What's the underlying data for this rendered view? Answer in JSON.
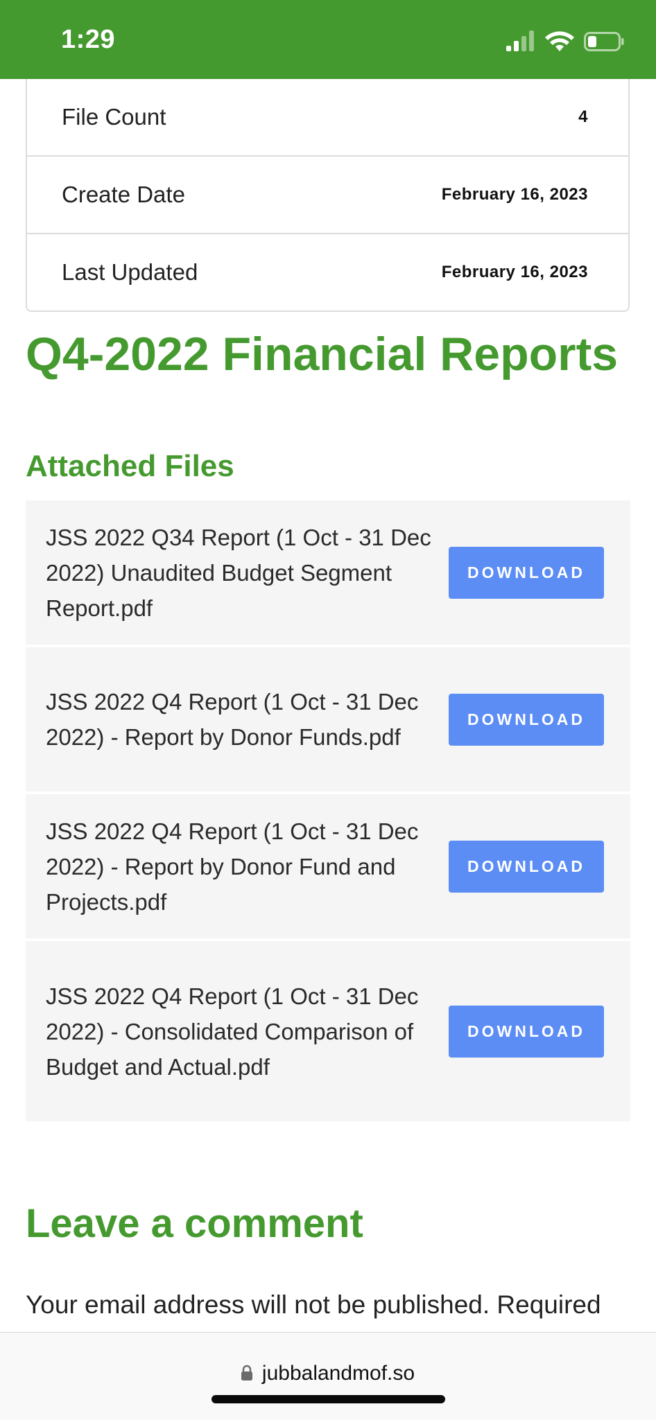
{
  "status_bar": {
    "time": "1:29",
    "background_color": "#459a2f",
    "icons": [
      "cellular-signal-icon",
      "wifi-icon",
      "battery-icon"
    ]
  },
  "meta": {
    "rows": [
      {
        "label": "File Count",
        "value": "4"
      },
      {
        "label": "Create Date",
        "value": "February 16, 2023"
      },
      {
        "label": "Last Updated",
        "value": "February 16, 2023"
      }
    ]
  },
  "page": {
    "title": "Q4-2022 Financial Reports",
    "attached_files_heading": "Attached Files",
    "accent_color": "#459a2f"
  },
  "files": [
    {
      "name": "JSS 2022 Q34 Report (1 Oct - 31 Dec 2022) Unaudited Budget Segment Report.pdf",
      "button": "Download"
    },
    {
      "name": "JSS 2022 Q4 Report (1 Oct - 31 Dec 2022) - Report by Donor Funds.pdf",
      "button": "Download"
    },
    {
      "name": "JSS 2022 Q4 Report (1 Oct - 31 Dec 2022) - Report by Donor Fund and Projects.pdf",
      "button": "Download"
    },
    {
      "name": "JSS 2022 Q4 Report (1 Oct - 31 Dec 2022) - Consolidated Comparison of Budget and Actual.pdf",
      "button": "Download"
    }
  ],
  "button_color": "#5b8df5",
  "comments": {
    "heading": "Leave a comment",
    "note": "Your email address will not be published. Required"
  },
  "browser": {
    "url": "jubbalandmof.so",
    "lock_icon": "lock-icon"
  }
}
